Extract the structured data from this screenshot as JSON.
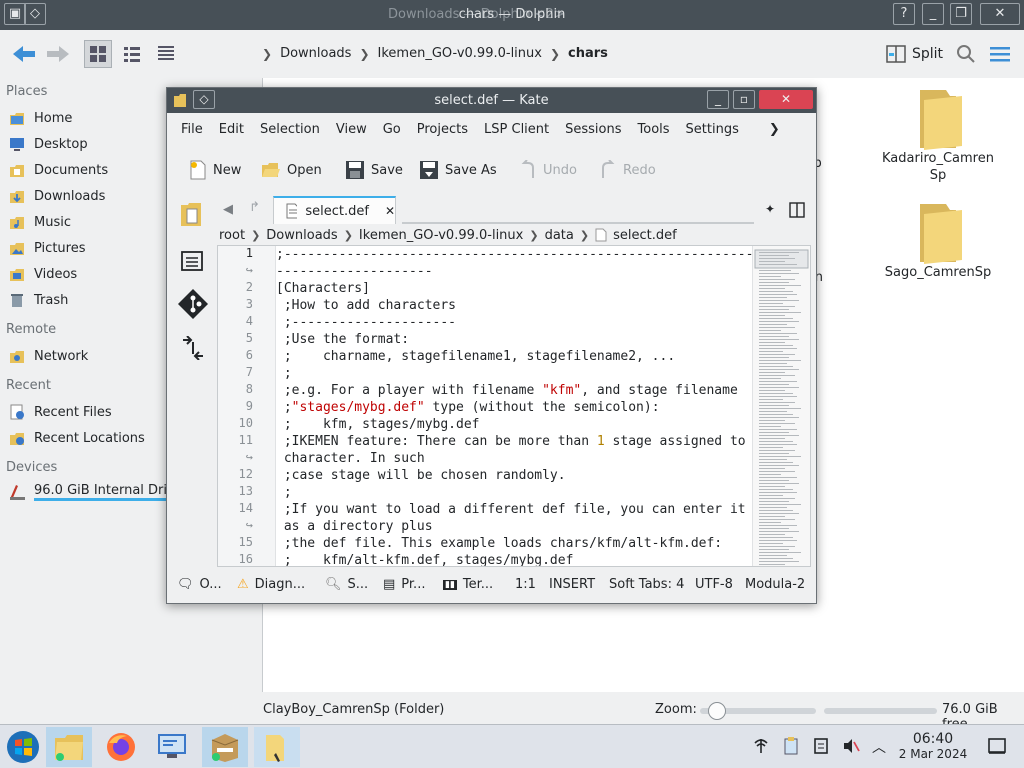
{
  "dolphin": {
    "title": "chars — Dolphin",
    "title_ghost": "Downloads — Dolphin <2>",
    "breadcrumbs": [
      "Downloads",
      "Ikemen_GO-v0.99.0-linux",
      "chars"
    ],
    "split_label": "Split",
    "places": {
      "header_places": "Places",
      "places_items": [
        "Home",
        "Desktop",
        "Documents",
        "Downloads",
        "Music",
        "Pictures",
        "Videos",
        "Trash"
      ],
      "header_remote": "Remote",
      "remote_items": [
        "Network"
      ],
      "header_recent": "Recent",
      "recent_items": [
        "Recent Files",
        "Recent Locations"
      ],
      "header_devices": "Devices",
      "device_items": [
        "96.0 GiB Internal Drive"
      ]
    },
    "folders": [
      "Kadariro_Camren\nSp",
      "Sago_CamrenSp"
    ],
    "folder_partial": [
      "enSp",
      "mren"
    ],
    "status_text": "ClayBoy_CamrenSp (Folder)",
    "zoom_label": "Zoom:",
    "zoom_value": 0.15,
    "free_space": "76.0 GiB free"
  },
  "kate": {
    "title": "select.def — Kate",
    "menu": [
      "File",
      "Edit",
      "Selection",
      "View",
      "Go",
      "Projects",
      "LSP Client",
      "Sessions",
      "Tools",
      "Settings"
    ],
    "toolbar": {
      "new": "New",
      "open": "Open",
      "save": "Save",
      "save_as": "Save As",
      "undo": "Undo",
      "redo": "Redo"
    },
    "tab_label": "select.def",
    "breadcrumb": [
      "root",
      "Downloads",
      "Ikemen_GO-v0.99.0-linux",
      "data",
      "select.def"
    ],
    "line_numbers": [
      "1",
      "↪",
      "2",
      "3",
      "4",
      "5",
      "6",
      "7",
      "8",
      "9",
      "10",
      "11",
      "↪",
      "12",
      "13",
      "14",
      "↪",
      "15",
      "16"
    ],
    "code_lines": [
      ";-------------------------------------------------------------",
      "--------------------",
      "[Characters]",
      " ;How to add characters",
      " ;---------------------",
      " ;Use the format:",
      " ;    charname, stagefilename1, stagefilename2, ...",
      " ;",
      " ;e.g. For a player with filename ",
      " ;",
      " ;    kfm, stages/mybg.def",
      " ;IKEMEN feature: There can be more than ",
      " character. In such",
      " ;case stage will be chosen randomly.",
      " ;",
      " ;If you want to load a different def file, you can enter it",
      " as a directory plus",
      " ;the def file. This example loads chars/kfm/alt-kfm.def:",
      " ;    kfm/alt-kfm.def, stages/mybg.def"
    ],
    "code_strings": {
      "kfm": "\"kfm\"",
      "after_kfm": ", and stage filename",
      "stage_path": "\"stages/mybg.def\"",
      "after_stage": " type (without the semicolon):",
      "one": "1",
      "after_one": " stage assigned to"
    },
    "status": {
      "output": "O...",
      "diagnostics": "Diagn...",
      "search": "S...",
      "projects": "Pr...",
      "terminal": "Ter...",
      "position": "1:1",
      "mode": "INSERT",
      "indent": "Soft Tabs: 4",
      "encoding": "UTF-8",
      "syntax": "Modula-2"
    }
  },
  "taskbar": {
    "time": "06:40",
    "date": "2 Mar 2024"
  },
  "colors": {
    "accent": "#3daee9",
    "titlebar": "#475057",
    "folder": "#f3d67b"
  }
}
